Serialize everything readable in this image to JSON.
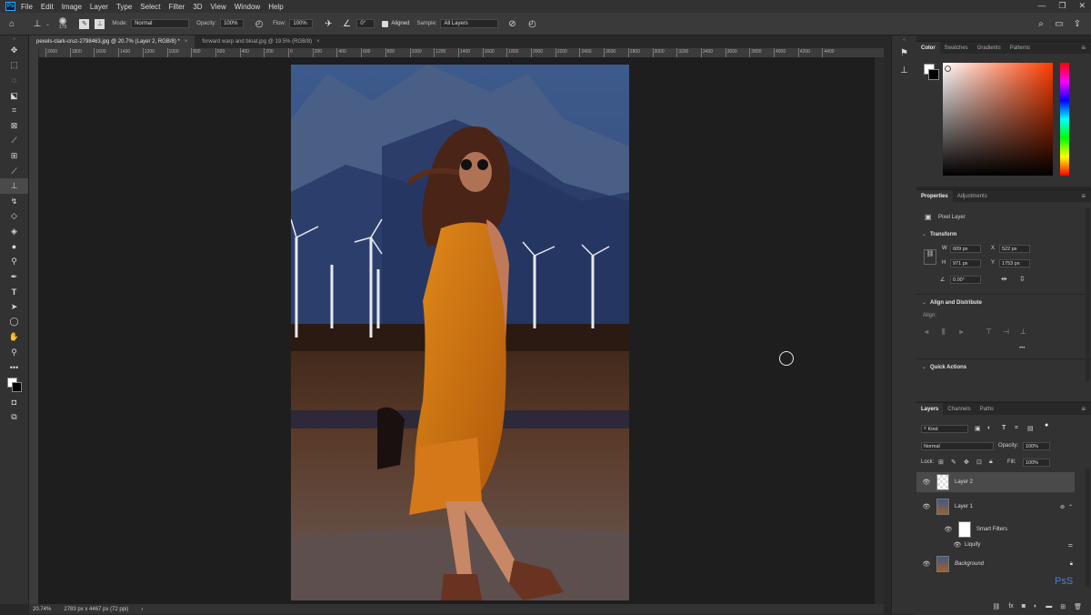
{
  "app_logo": "Ps",
  "menu": [
    "File",
    "Edit",
    "Image",
    "Layer",
    "Type",
    "Select",
    "Filter",
    "3D",
    "View",
    "Window",
    "Help"
  ],
  "window_controls": [
    "—",
    "❐",
    "✕"
  ],
  "options": {
    "brush_size": "175",
    "mode_label": "Mode:",
    "mode_value": "Normal",
    "opacity_label": "Opacity:",
    "opacity_value": "100%",
    "flow_label": "Flow:",
    "flow_value": "100%",
    "angle_value": "0°",
    "aligned_label": "Aligned",
    "sample_label": "Sample:",
    "sample_value": "All Layers"
  },
  "tabs": [
    {
      "label": "pexels-clark-cruz-2798463.jpg @ 20.7% (Layer 2, RGB/8) *",
      "active": true
    },
    {
      "label": "forward warp and bloat.jpg @ 19.5% (RGB/8)",
      "active": false
    }
  ],
  "ruler_ticks": [
    "2000",
    "1800",
    "1600",
    "1400",
    "1200",
    "1000",
    "800",
    "600",
    "400",
    "200",
    "0",
    "200",
    "400",
    "600",
    "800",
    "1000",
    "1200",
    "1400",
    "1600",
    "1800",
    "2000",
    "2200",
    "2400",
    "2600",
    "2800",
    "3000",
    "3200",
    "3400",
    "3600",
    "3800",
    "4000",
    "4200",
    "4400"
  ],
  "status": {
    "zoom": "20.74%",
    "doc_info": "2783 px x 4467 px (72 ppi)"
  },
  "color_panel": {
    "tabs": [
      "Color",
      "Swatches",
      "Gradients",
      "Patterns"
    ],
    "hue_color": "#ff3c00"
  },
  "properties": {
    "tabs": [
      "Properties",
      "Adjustments"
    ],
    "kind": "Pixel Layer",
    "transform_title": "Transform",
    "w_label": "W",
    "w_value": "609 px",
    "h_label": "H",
    "h_value": "971 px",
    "x_label": "X",
    "x_value": "522 px",
    "y_label": "Y",
    "y_value": "1753 px",
    "angle_value": "0.00°",
    "align_title": "Align and Distribute",
    "align_label": "Align:",
    "more": "•••",
    "quick_actions_title": "Quick Actions"
  },
  "layers_panel": {
    "tabs": [
      "Layers",
      "Channels",
      "Paths"
    ],
    "filter_kind": "Kind",
    "blend_mode": "Normal",
    "opacity_label": "Opacity:",
    "opacity_value": "100%",
    "lock_label": "Lock:",
    "fill_label": "Fill:",
    "fill_value": "100%",
    "layers": [
      {
        "name": "Layer 2",
        "selected": true
      },
      {
        "name": "Layer 1",
        "selected": false
      },
      {
        "name": "Smart Filters",
        "selected": false
      },
      {
        "name": "Liquify",
        "selected": false
      },
      {
        "name": "Background",
        "selected": false
      }
    ],
    "watermark": "PsS"
  }
}
